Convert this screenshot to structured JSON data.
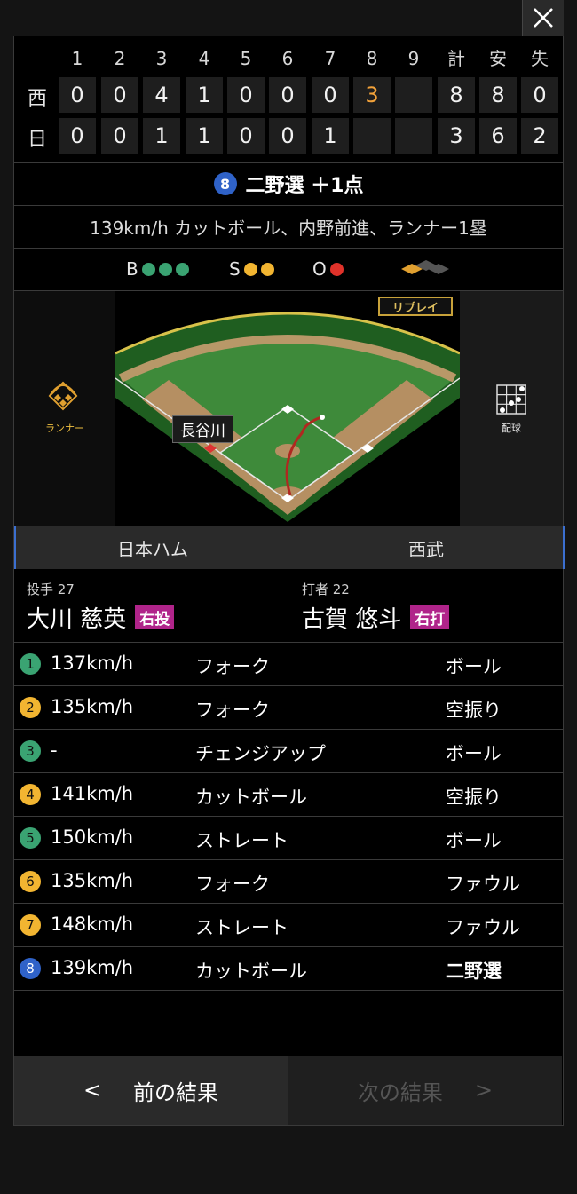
{
  "close_label": "×",
  "scoreboard": {
    "innings": [
      "1",
      "2",
      "3",
      "4",
      "5",
      "6",
      "7",
      "8",
      "9"
    ],
    "totals_headers": [
      "計",
      "安",
      "失"
    ],
    "teams": [
      {
        "abbr": "西",
        "scores": [
          "0",
          "0",
          "4",
          "1",
          "0",
          "0",
          "0",
          "3",
          ""
        ],
        "totals": [
          "8",
          "8",
          "0"
        ]
      },
      {
        "abbr": "日",
        "scores": [
          "0",
          "0",
          "1",
          "1",
          "0",
          "0",
          "1",
          "",
          ""
        ],
        "totals": [
          "3",
          "6",
          "2"
        ]
      }
    ]
  },
  "play": {
    "number": "8",
    "title": "二野選 ＋1点",
    "description": "139km/h カットボール、内野前進、ランナー1塁"
  },
  "count": {
    "b_label": "B",
    "s_label": "S",
    "o_label": "O",
    "balls": 3,
    "strikes": 2,
    "outs": 1
  },
  "field": {
    "runner_label": "ランナー",
    "pitch_chart_label": "配球",
    "replay_label": "リプレイ",
    "runner_name": "長谷川"
  },
  "teams": {
    "left": "日本ハム",
    "right": "西武"
  },
  "pitcher": {
    "role": "投手 27",
    "name": "大川 慈英",
    "hand": "右投"
  },
  "batter": {
    "role": "打者 22",
    "name": "古賀 悠斗",
    "hand": "右打"
  },
  "pitches": [
    {
      "no": "1",
      "speed": "137km/h",
      "type": "フォーク",
      "result": "ボール",
      "color": "#3aa372"
    },
    {
      "no": "2",
      "speed": "135km/h",
      "type": "フォーク",
      "result": "空振り",
      "color": "#f2b531"
    },
    {
      "no": "3",
      "speed": "-",
      "type": "チェンジアップ",
      "result": "ボール",
      "color": "#3aa372"
    },
    {
      "no": "4",
      "speed": "141km/h",
      "type": "カットボール",
      "result": "空振り",
      "color": "#f2b531"
    },
    {
      "no": "5",
      "speed": "150km/h",
      "type": "ストレート",
      "result": "ボール",
      "color": "#3aa372"
    },
    {
      "no": "6",
      "speed": "135km/h",
      "type": "フォーク",
      "result": "ファウル",
      "color": "#f2b531"
    },
    {
      "no": "7",
      "speed": "148km/h",
      "type": "ストレート",
      "result": "ファウル",
      "color": "#f2b531"
    },
    {
      "no": "8",
      "speed": "139km/h",
      "type": "カットボール",
      "result": "二野選",
      "color": "#2f62c8"
    }
  ],
  "footer": {
    "prev_arrow": "<",
    "prev_label": "前の結果",
    "next_label": "次の結果",
    "next_arrow": ">"
  },
  "colors": {
    "ball": "#3aa372",
    "strike": "#f2b531",
    "out": "#e0322a",
    "accent_score": "#f2a23a"
  }
}
